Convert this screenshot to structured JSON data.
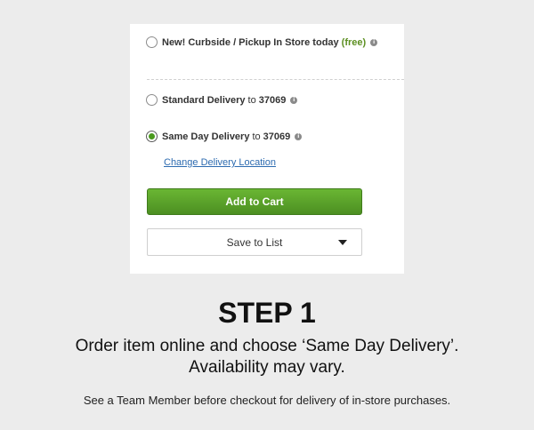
{
  "delivery_card": {
    "options": [
      {
        "label": "New! Curbside / Pickup In Store today",
        "badge": "(free)",
        "badge_color": "#5c8f21",
        "icon": "info-icon",
        "selected": false
      },
      {
        "label": "Standard Delivery",
        "connector": "to",
        "zip": "37069",
        "icon": "info-icon",
        "selected": false
      },
      {
        "label": "Same Day Delivery",
        "connector": "to",
        "zip": "37069",
        "icon": "info-icon",
        "selected": true
      }
    ],
    "change_location_link": "Change Delivery Location",
    "add_to_cart_label": "Add to Cart",
    "save_to_list_label": "Save to List",
    "info_glyph": "i",
    "accent_color": "#4c8f22",
    "link_color": "#2d6bb0"
  },
  "step": {
    "title": "STEP 1",
    "line1": "Order item online and choose ‘Same Day Delivery’.",
    "line2": "Availability may vary.",
    "note": "See a Team Member before checkout for delivery of in-store purchases."
  }
}
